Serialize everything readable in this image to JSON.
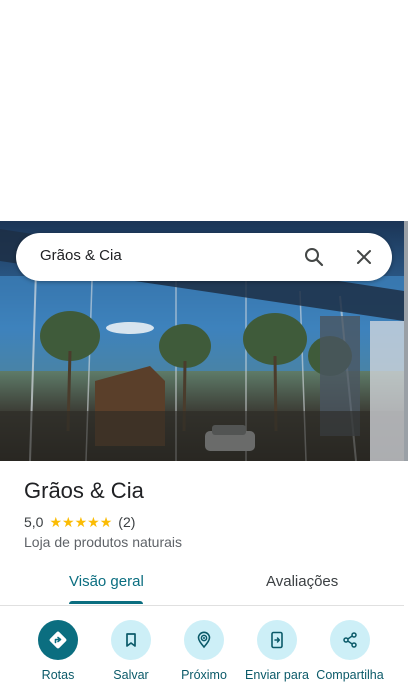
{
  "search": {
    "query": "Grãos & Cia"
  },
  "place": {
    "name": "Grãos & Cia",
    "rating": "5,0",
    "stars": 5,
    "review_count": "(2)",
    "category": "Loja de produtos naturais"
  },
  "tabs": [
    {
      "label": "Visão geral",
      "active": true
    },
    {
      "label": "Avaliações",
      "active": false
    }
  ],
  "actions": [
    {
      "label": "Rotas",
      "icon": "directions-icon"
    },
    {
      "label": "Salvar",
      "icon": "bookmark-icon"
    },
    {
      "label": "Próximo",
      "icon": "nearby-icon"
    },
    {
      "label": "Enviar para",
      "icon": "send-to-phone-icon"
    },
    {
      "label": "Compartilha",
      "icon": "share-icon"
    }
  ],
  "colors": {
    "accent": "#0b6e80",
    "action_bg": "#cdeff7",
    "star": "#fbbc04"
  }
}
